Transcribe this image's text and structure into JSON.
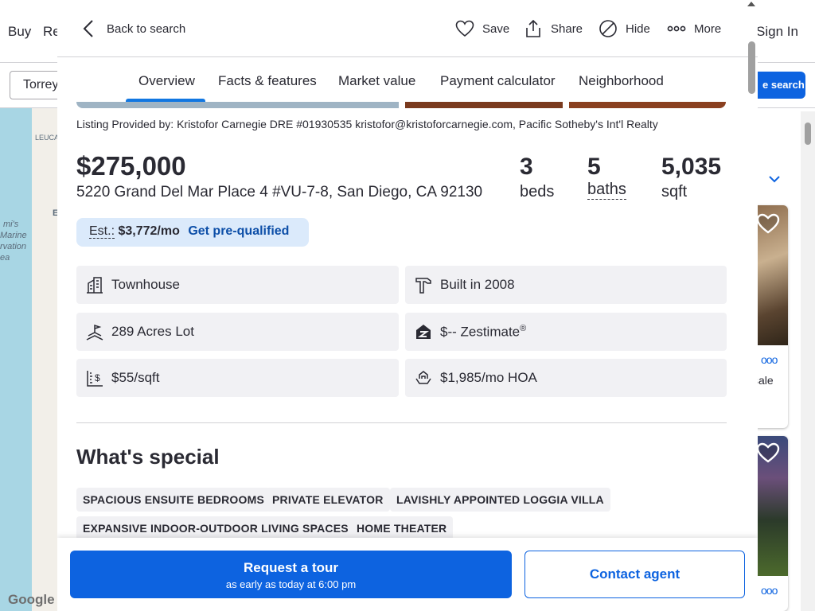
{
  "background": {
    "nav_items": [
      "Buy",
      "Re",
      "Sign In"
    ],
    "search_value": "Torrey",
    "save_search_label": "e search",
    "map_labels": [
      "LEUCA",
      "mi's",
      "Marine",
      "rvation",
      "ea",
      "E"
    ],
    "map_logo": "Google",
    "dropdown_fragment": "u",
    "card_fragment": [
      "sale",
      "."
    ]
  },
  "header": {
    "back_label": "Back to search",
    "actions": {
      "save": "Save",
      "share": "Share",
      "hide": "Hide",
      "more": "More"
    }
  },
  "tabs": [
    "Overview",
    "Facts & features",
    "Market value",
    "Payment calculator",
    "Neighborhood"
  ],
  "listing": {
    "provided_by": "Listing Provided by: Kristofor Carnegie DRE #01930535 kristofor@kristoforcarnegie.com, Pacific Sotheby's Int'l Realty",
    "price": "$275,000",
    "address": "5220 Grand Del Mar Place 4 #VU-7-8, San Diego, CA 92130",
    "beds": {
      "value": "3",
      "label": "beds"
    },
    "baths": {
      "value": "5",
      "label": "baths"
    },
    "sqft": {
      "value": "5,035",
      "label": "sqft"
    },
    "estimate": {
      "label": "Est.:",
      "value": "$3,772/mo",
      "cta": "Get pre-qualified"
    }
  },
  "facts": {
    "type": "Townhouse",
    "built": "Built in 2008",
    "lot": "289 Acres Lot",
    "zestimate": "$-- Zestimate",
    "zestimate_mark": "®",
    "price_per_sqft": "$55/sqft",
    "hoa": "$1,985/mo HOA"
  },
  "whats_special": {
    "title": "What's special",
    "chips": [
      "SPACIOUS ENSUITE BEDROOMS",
      "PRIVATE ELEVATOR",
      "LAVISHLY APPOINTED LOGGIA VILLA",
      "EXPANSIVE INDOOR-OUTDOOR LIVING SPACES",
      "HOME THEATER"
    ]
  },
  "footer": {
    "tour_label": "Request a tour",
    "tour_sub": "as early as today at 6:00 pm",
    "contact_label": "Contact agent"
  },
  "colors": {
    "accent": "#0d63e0",
    "estimate_bg": "#dbeafb",
    "fact_bg": "#f1f1f4",
    "tab_underline": "#1277e1"
  }
}
